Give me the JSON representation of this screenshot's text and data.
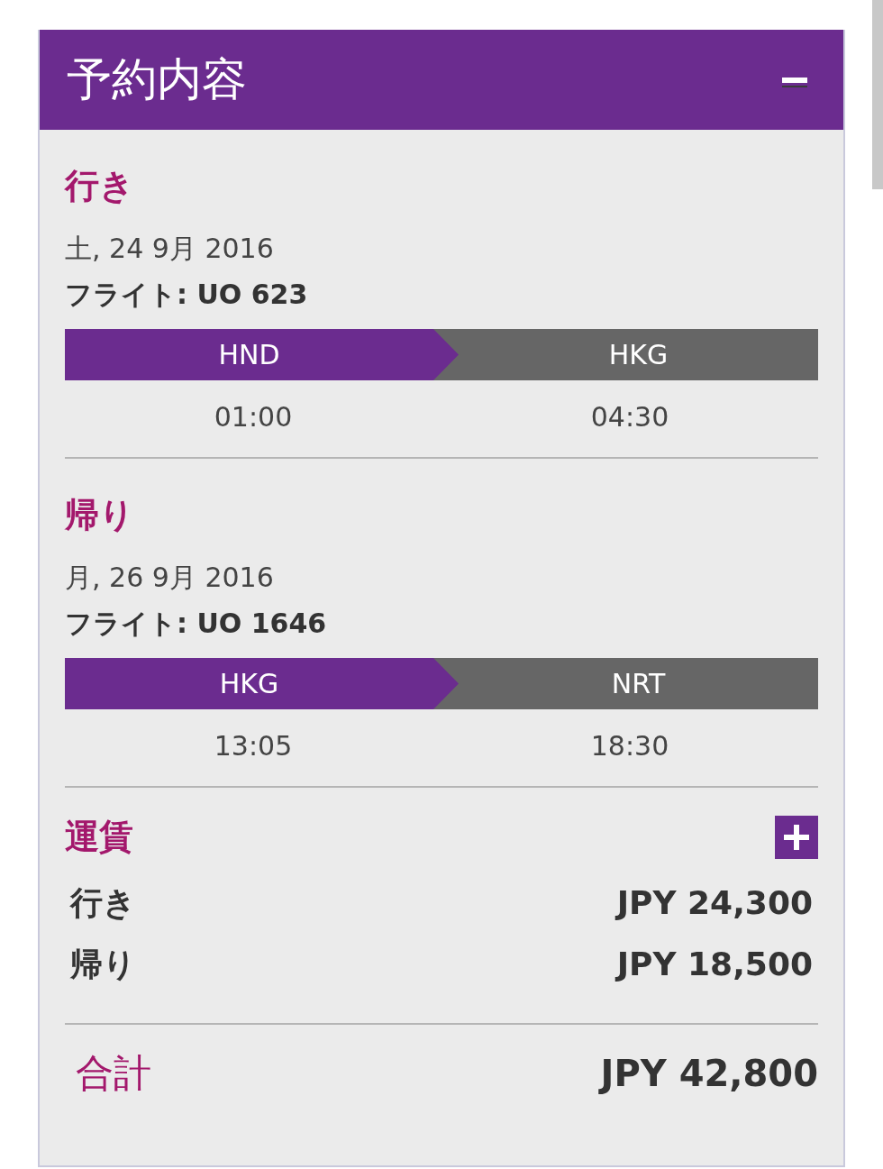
{
  "header": {
    "title": "予約内容",
    "expanded": true
  },
  "flights": [
    {
      "heading": "行き",
      "date": "土, 24 9月 2016",
      "flight": "フライト: UO 623",
      "origin": "HND",
      "destination": "HKG",
      "depart_time": "01:00",
      "arrive_time": "04:30"
    },
    {
      "heading": "帰り",
      "date": "月, 26 9月 2016",
      "flight": "フライト: UO 1646",
      "origin": "HKG",
      "destination": "NRT",
      "depart_time": "13:05",
      "arrive_time": "18:30"
    }
  ],
  "fare": {
    "heading": "運賃",
    "expanded": false,
    "rows": [
      {
        "label": "行き",
        "amount": "JPY 24,300"
      },
      {
        "label": "帰り",
        "amount": "JPY 18,500"
      }
    ],
    "total_label": "合計",
    "total_amount": "JPY 42,800"
  }
}
